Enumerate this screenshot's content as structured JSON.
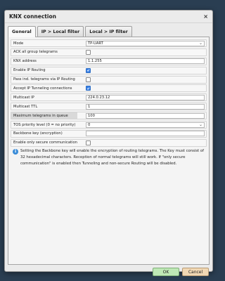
{
  "dialog": {
    "title": "KNX connection",
    "close_glyph": "×"
  },
  "tabs": [
    {
      "label": "General",
      "active": true
    },
    {
      "label": "IP > Local filter",
      "active": false
    },
    {
      "label": "Local > IP filter",
      "active": false
    }
  ],
  "form": {
    "mode": {
      "label": "Mode",
      "value": "TP-UART"
    },
    "ack_all": {
      "label": "ACK all group telegrams",
      "checked": false
    },
    "knx_address": {
      "label": "KNX address",
      "value": "1.1.255"
    },
    "enable_ip_routing": {
      "label": "Enable IP Routing",
      "checked": true
    },
    "pass_ind": {
      "label": "Pass ind. telegrams via IP Routing",
      "checked": false
    },
    "accept_tunneling": {
      "label": "Accept IP Tunneling connections",
      "checked": true
    },
    "multicast_ip": {
      "label": "Multicast IP",
      "value": "224.0.23.12"
    },
    "multicast_ttl": {
      "label": "Multicast TTL",
      "value": "1"
    },
    "max_telegrams": {
      "label": "Maximum telegrams in queue",
      "value": "100"
    },
    "tos_priority": {
      "label": "TOS priority level (0 = no priority)",
      "value": "0"
    },
    "backbone_key": {
      "label": "Backbone key (encryption)",
      "value": ""
    },
    "secure_only": {
      "label": "Enable only secure communication",
      "checked": false
    }
  },
  "info_text": "Setting the Backbone key will enable the encryption of routing telegrams. The Key must consist of 32 hexadecimal characters. Reception of normal telegrams will still work. If \"only secure communication\" is enabled then Tunneling and non-secure Routing will be disabled.",
  "buttons": {
    "ok": "OK",
    "cancel": "Cancel"
  },
  "colors": {
    "background": "#2a3e52",
    "check_accent": "#3b82e6",
    "ok_button": "#bfe8b6",
    "cancel_button": "#f1d8b4",
    "info_icon": "#3a8cd8"
  },
  "icons": {
    "info": "info-icon",
    "checkmark": "check-icon",
    "dropdown": "chevron-down-icon"
  }
}
